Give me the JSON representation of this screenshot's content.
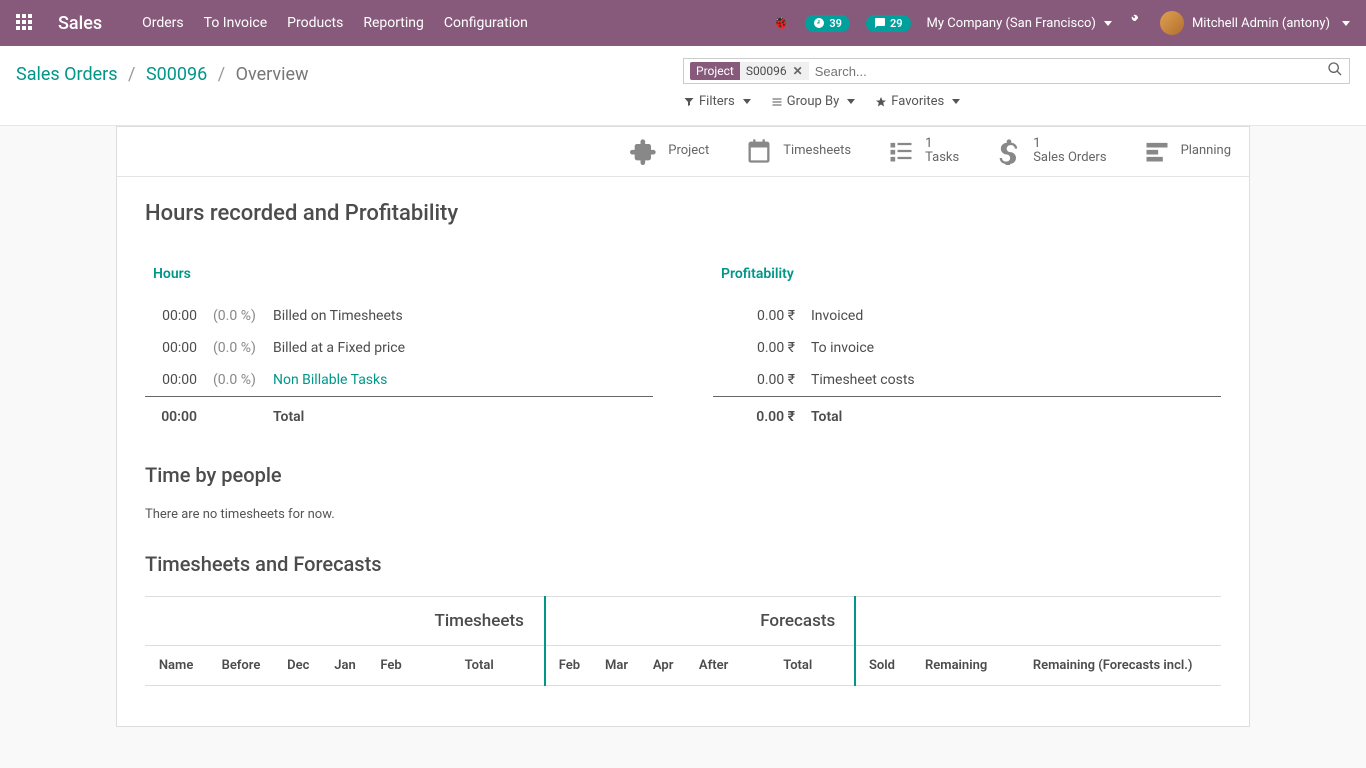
{
  "topbar": {
    "brand": "Sales",
    "nav": [
      "Orders",
      "To Invoice",
      "Products",
      "Reporting",
      "Configuration"
    ],
    "badge_refresh": "39",
    "badge_chat": "29",
    "company": "My Company (San Francisco)",
    "user": "Mitchell Admin (antony)"
  },
  "breadcrumb": {
    "root": "Sales Orders",
    "parent": "S00096",
    "current": "Overview"
  },
  "search": {
    "facet_label": "Project",
    "facet_value": "S00096",
    "placeholder": "Search...",
    "filters": "Filters",
    "groupby": "Group By",
    "favorites": "Favorites"
  },
  "stat_buttons": {
    "project": "Project",
    "timesheets": "Timesheets",
    "tasks_count": "1",
    "tasks": "Tasks",
    "so_count": "1",
    "so": "Sales Orders",
    "planning": "Planning"
  },
  "sections": {
    "h1": "Hours recorded and Profitability",
    "hours_title": "Hours",
    "hours_rows": [
      {
        "val": "00:00",
        "pct": "(0.0 %)",
        "label": "Billed on Timesheets",
        "link": false
      },
      {
        "val": "00:00",
        "pct": "(0.0 %)",
        "label": "Billed at a Fixed price",
        "link": false
      },
      {
        "val": "00:00",
        "pct": "(0.0 %)",
        "label": "Non Billable Tasks",
        "link": true
      }
    ],
    "hours_total_val": "00:00",
    "hours_total_label": "Total",
    "profit_title": "Profitability",
    "profit_rows": [
      {
        "val": "0.00 ₹",
        "label": "Invoiced"
      },
      {
        "val": "0.00 ₹",
        "label": "To invoice"
      },
      {
        "val": "0.00 ₹",
        "label": "Timesheet costs"
      }
    ],
    "profit_total_val": "0.00 ₹",
    "profit_total_label": "Total",
    "h2_time": "Time by people",
    "empty": "There are no timesheets for now.",
    "h2_forecast": "Timesheets and Forecasts",
    "grid_group1": "Timesheets",
    "grid_group2": "Forecasts",
    "grid_cols": [
      "Name",
      "Before",
      "Dec",
      "Jan",
      "Feb",
      "Total",
      "Feb",
      "Mar",
      "Apr",
      "After",
      "Total",
      "Sold",
      "Remaining",
      "Remaining (Forecasts incl.)"
    ]
  }
}
